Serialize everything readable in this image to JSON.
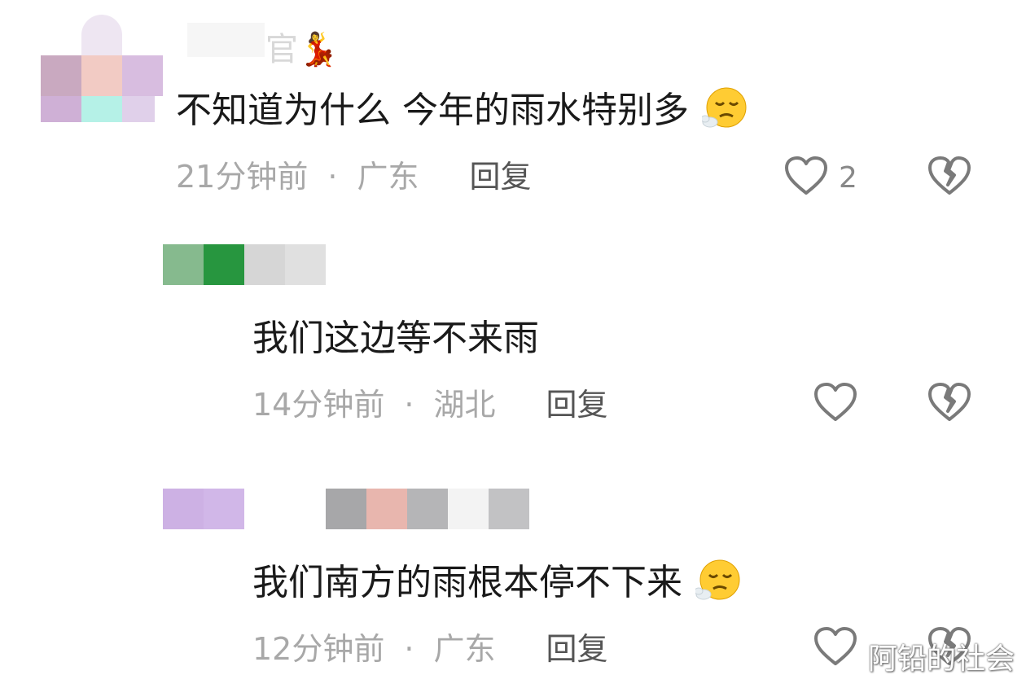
{
  "colors": {
    "text": "#1a1a1a",
    "meta": "#a8a8a8",
    "reply": "#555555",
    "icon": "#7a7a7a"
  },
  "comments": [
    {
      "username_suffix": "官💃",
      "text": "不知道为什么  今年的雨水特别多",
      "emoji": "😮‍💨",
      "time": "21分钟前",
      "separator": "·",
      "location": "广东",
      "reply_label": "回复",
      "like_count": "2",
      "like_icon": "heart-outline-icon",
      "dislike_icon": "broken-heart-icon"
    },
    {
      "text": "我们这边等不来雨",
      "time": "14分钟前",
      "separator": "·",
      "location": "湖北",
      "reply_label": "回复",
      "like_icon": "heart-outline-icon",
      "dislike_icon": "broken-heart-icon"
    },
    {
      "text": "我们南方的雨根本停不下来",
      "emoji": "😮‍💨",
      "time": "12分钟前",
      "separator": "·",
      "location": "广东",
      "reply_label": "回复",
      "like_icon": "heart-outline-icon",
      "dislike_icon": "broken-heart-icon"
    }
  ],
  "watermark": "阿铅的社会"
}
